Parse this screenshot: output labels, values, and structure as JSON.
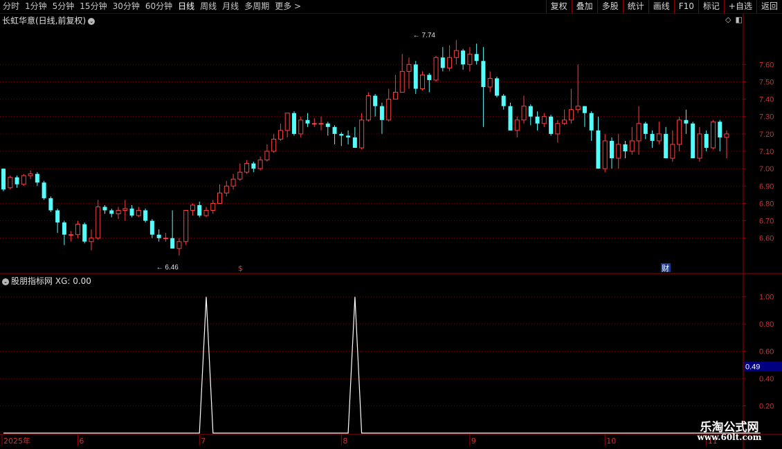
{
  "toolbar": {
    "period_tabs": [
      {
        "label": "分时"
      },
      {
        "label": "1分钟"
      },
      {
        "label": "5分钟"
      },
      {
        "label": "15分钟"
      },
      {
        "label": "30分钟"
      },
      {
        "label": "60分钟"
      },
      {
        "label": "日线",
        "active": true
      },
      {
        "label": "周线"
      },
      {
        "label": "月线"
      },
      {
        "label": "多周期"
      },
      {
        "label": "更多 >"
      }
    ],
    "right_tools": [
      {
        "label": "复权"
      },
      {
        "label": "叠加"
      },
      {
        "label": "多股"
      },
      {
        "label": "统计"
      },
      {
        "label": "画线"
      },
      {
        "label": "F10"
      },
      {
        "label": "标记"
      },
      {
        "label": "+自选"
      },
      {
        "label": "返回"
      }
    ]
  },
  "main_panel": {
    "title": "长虹华意(日线,前复权)",
    "icons": [
      "diamond-icon",
      "restore-icon"
    ]
  },
  "sub_panel": {
    "indicator": "股朋指标网",
    "value_text": "XG: 0.00",
    "current_value_tag": "0.49"
  },
  "watermark": {
    "name": "乐淘公式网",
    "url": "www.60lt.com"
  },
  "colors": {
    "up": "#ff4040",
    "down": "#54fcfc",
    "grid": "#7a0000",
    "frame": "#a00000",
    "axis_text": "#cc3333",
    "indicator_line": "#ffffff",
    "tag_bg": "#000080"
  },
  "chart_data": {
    "type": "candlestick",
    "price_axis": {
      "ticks": [
        7.6,
        7.5,
        7.4,
        7.3,
        7.2,
        7.1,
        7.0,
        6.9,
        6.8,
        6.7,
        6.6
      ],
      "range": [
        6.4,
        7.82
      ]
    },
    "annotations": {
      "high": {
        "label": "7.74",
        "value": 7.74,
        "index": 61
      },
      "low": {
        "label": "6.46",
        "value": 6.46,
        "index": 23
      }
    },
    "markers": [
      {
        "label": "$",
        "index": 35
      },
      {
        "label": "财",
        "index": 98
      }
    ],
    "time_axis": [
      {
        "label": "2025年",
        "index": 0
      },
      {
        "label": "6",
        "index": 11
      },
      {
        "label": "7",
        "index": 29
      },
      {
        "label": "8",
        "index": 50
      },
      {
        "label": "9",
        "index": 69
      },
      {
        "label": "10",
        "index": 89
      },
      {
        "label": "11",
        "index": 104
      }
    ],
    "indicator": {
      "name": "XG",
      "y_ticks": [
        1.0,
        0.8,
        0.6,
        0.4,
        0.2
      ],
      "range": [
        0,
        1.1
      ],
      "spike_indices": [
        30,
        52
      ],
      "count": 113
    },
    "candles": [
      [
        7.0,
        6.88,
        7.0,
        6.87
      ],
      [
        6.89,
        6.95,
        6.96,
        6.88
      ],
      [
        6.95,
        6.91,
        6.96,
        6.89
      ],
      [
        6.91,
        6.96,
        6.97,
        6.9
      ],
      [
        6.96,
        6.97,
        6.99,
        6.94
      ],
      [
        6.97,
        6.92,
        6.98,
        6.9
      ],
      [
        6.92,
        6.83,
        6.93,
        6.82
      ],
      [
        6.83,
        6.76,
        6.84,
        6.75
      ],
      [
        6.76,
        6.69,
        6.77,
        6.63
      ],
      [
        6.69,
        6.62,
        6.7,
        6.56
      ],
      [
        6.62,
        6.62,
        6.64,
        6.58
      ],
      [
        6.62,
        6.68,
        6.7,
        6.6
      ],
      [
        6.68,
        6.58,
        6.69,
        6.57
      ],
      [
        6.58,
        6.6,
        6.65,
        6.53
      ],
      [
        6.6,
        6.78,
        6.82,
        6.59
      ],
      [
        6.78,
        6.76,
        6.79,
        6.74
      ],
      [
        6.76,
        6.74,
        6.77,
        6.72
      ],
      [
        6.74,
        6.76,
        6.78,
        6.71
      ],
      [
        6.76,
        6.77,
        6.82,
        6.7
      ],
      [
        6.77,
        6.73,
        6.79,
        6.72
      ],
      [
        6.73,
        6.76,
        6.78,
        6.72
      ],
      [
        6.76,
        6.7,
        6.77,
        6.69
      ],
      [
        6.7,
        6.62,
        6.71,
        6.6
      ],
      [
        6.62,
        6.6,
        6.65,
        6.58
      ],
      [
        6.6,
        6.6,
        6.63,
        6.58
      ],
      [
        6.6,
        6.54,
        6.76,
        6.54
      ],
      [
        6.54,
        6.58,
        6.6,
        6.5
      ],
      [
        6.58,
        6.76,
        6.76,
        6.56
      ],
      [
        6.76,
        6.79,
        6.8,
        6.73
      ],
      [
        6.79,
        6.73,
        6.81,
        6.72
      ],
      [
        6.73,
        6.76,
        6.78,
        6.72
      ],
      [
        6.76,
        6.8,
        6.82,
        6.74
      ],
      [
        6.8,
        6.86,
        6.91,
        6.8
      ],
      [
        6.86,
        6.9,
        6.93,
        6.84
      ],
      [
        6.9,
        6.94,
        6.97,
        6.88
      ],
      [
        6.94,
        6.98,
        7.03,
        6.93
      ],
      [
        6.98,
        7.03,
        7.05,
        6.97
      ],
      [
        7.03,
        7.0,
        7.04,
        6.98
      ],
      [
        7.0,
        7.05,
        7.07,
        6.99
      ],
      [
        7.05,
        7.1,
        7.14,
        7.04
      ],
      [
        7.1,
        7.17,
        7.2,
        7.09
      ],
      [
        7.17,
        7.22,
        7.26,
        7.16
      ],
      [
        7.22,
        7.32,
        7.32,
        7.18
      ],
      [
        7.32,
        7.2,
        7.33,
        7.19
      ],
      [
        7.2,
        7.28,
        7.3,
        7.18
      ],
      [
        7.28,
        7.26,
        7.32,
        7.24
      ],
      [
        7.26,
        7.26,
        7.29,
        7.24
      ],
      [
        7.26,
        7.26,
        7.3,
        7.22
      ],
      [
        7.26,
        7.24,
        7.27,
        7.19
      ],
      [
        7.24,
        7.2,
        7.25,
        7.14
      ],
      [
        7.2,
        7.19,
        7.21,
        7.13
      ],
      [
        7.19,
        7.18,
        7.22,
        7.14
      ],
      [
        7.18,
        7.12,
        7.24,
        7.12
      ],
      [
        7.12,
        7.28,
        7.32,
        7.11
      ],
      [
        7.28,
        7.42,
        7.44,
        7.27
      ],
      [
        7.42,
        7.36,
        7.43,
        7.3
      ],
      [
        7.36,
        7.28,
        7.38,
        7.2
      ],
      [
        7.28,
        7.4,
        7.46,
        7.27
      ],
      [
        7.4,
        7.44,
        7.54,
        7.4
      ],
      [
        7.44,
        7.56,
        7.66,
        7.44
      ],
      [
        7.56,
        7.6,
        7.64,
        7.46
      ],
      [
        7.6,
        7.46,
        7.62,
        7.43
      ],
      [
        7.46,
        7.54,
        7.56,
        7.45
      ],
      [
        7.54,
        7.51,
        7.55,
        7.44
      ],
      [
        7.51,
        7.64,
        7.65,
        7.5
      ],
      [
        7.64,
        7.58,
        7.7,
        7.56
      ],
      [
        7.58,
        7.64,
        7.71,
        7.56
      ],
      [
        7.64,
        7.68,
        7.74,
        7.6
      ],
      [
        7.68,
        7.6,
        7.69,
        7.57
      ],
      [
        7.6,
        7.66,
        7.7,
        7.56
      ],
      [
        7.66,
        7.62,
        7.72,
        7.6
      ],
      [
        7.62,
        7.47,
        7.7,
        7.24
      ],
      [
        7.47,
        7.52,
        7.56,
        7.44
      ],
      [
        7.52,
        7.42,
        7.53,
        7.41
      ],
      [
        7.42,
        7.36,
        7.43,
        7.34
      ],
      [
        7.36,
        7.22,
        7.38,
        7.22
      ],
      [
        7.22,
        7.28,
        7.3,
        7.18
      ],
      [
        7.28,
        7.36,
        7.42,
        7.26
      ],
      [
        7.36,
        7.3,
        7.37,
        7.25
      ],
      [
        7.3,
        7.26,
        7.33,
        7.22
      ],
      [
        7.26,
        7.3,
        7.32,
        7.24
      ],
      [
        7.3,
        7.2,
        7.31,
        7.19
      ],
      [
        7.2,
        7.26,
        7.28,
        7.15
      ],
      [
        7.26,
        7.28,
        7.34,
        7.25
      ],
      [
        7.28,
        7.34,
        7.46,
        7.26
      ],
      [
        7.34,
        7.36,
        7.6,
        7.32
      ],
      [
        7.36,
        7.32,
        7.36,
        7.24
      ],
      [
        7.32,
        7.22,
        7.33,
        7.16
      ],
      [
        7.22,
        7.0,
        7.3,
        7.0
      ],
      [
        7.0,
        7.16,
        7.2,
        6.98
      ],
      [
        7.16,
        7.06,
        7.18,
        7.0
      ],
      [
        7.06,
        7.14,
        7.2,
        7.0
      ],
      [
        7.14,
        7.1,
        7.16,
        7.06
      ],
      [
        7.1,
        7.16,
        7.24,
        7.08
      ],
      [
        7.16,
        7.26,
        7.36,
        7.08
      ],
      [
        7.26,
        7.2,
        7.27,
        7.17
      ],
      [
        7.2,
        7.16,
        7.22,
        7.12
      ],
      [
        7.16,
        7.2,
        7.27,
        7.14
      ],
      [
        7.2,
        7.06,
        7.24,
        7.06
      ],
      [
        7.06,
        7.14,
        7.22,
        7.04
      ],
      [
        7.14,
        7.28,
        7.3,
        7.1
      ],
      [
        7.28,
        7.26,
        7.34,
        7.2
      ],
      [
        7.26,
        7.06,
        7.27,
        7.06
      ],
      [
        7.06,
        7.2,
        7.24,
        7.04
      ],
      [
        7.2,
        7.12,
        7.22,
        7.1
      ],
      [
        7.12,
        7.27,
        7.28,
        7.11
      ],
      [
        7.27,
        7.18,
        7.28,
        7.1
      ],
      [
        7.18,
        7.2,
        7.22,
        7.06
      ]
    ]
  }
}
